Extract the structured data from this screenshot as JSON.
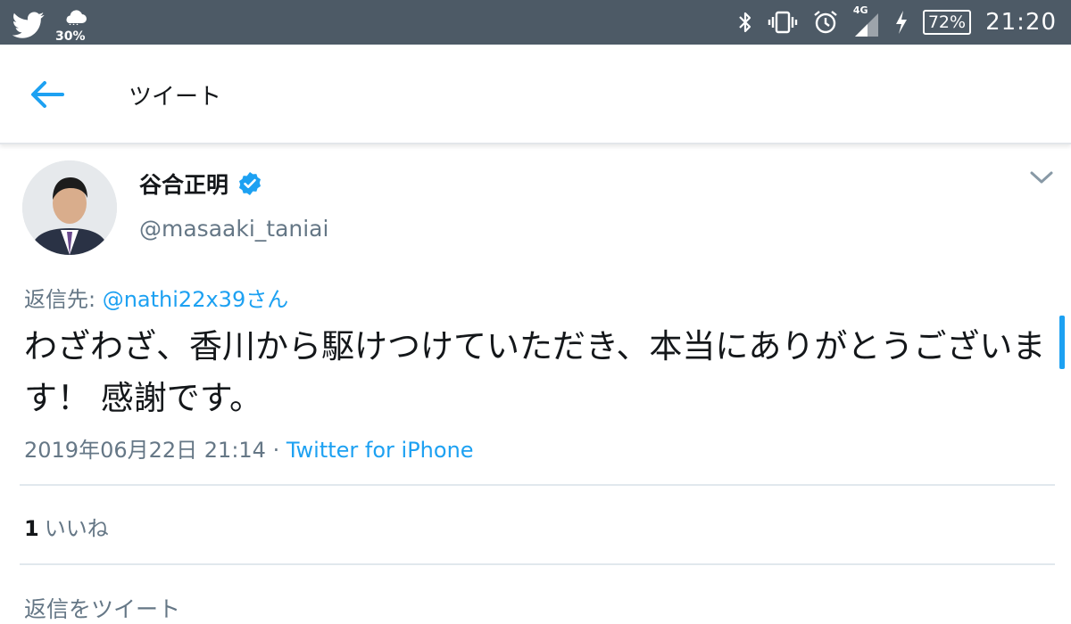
{
  "status_bar": {
    "weather_percent": "30%",
    "network_label": "4G",
    "battery": "72%",
    "time": "21:20",
    "icons": [
      "twitter-icon",
      "cloud-icon",
      "bluetooth-icon",
      "vibrate-icon",
      "alarm-icon",
      "signal-icon",
      "charging-icon",
      "battery-icon"
    ]
  },
  "header": {
    "title": "ツイート"
  },
  "tweet": {
    "author_name": "谷合正明",
    "author_handle": "@masaaki_taniai",
    "reply_prefix": "返信先: ",
    "reply_to": "@nathi22x39さん",
    "text": "わざわざ、香川から駆けつけていただき、本当にありがとうございます！ 感謝です。",
    "timestamp": "2019年06月22日 21:14",
    "separator": " · ",
    "source": "Twitter for iPhone",
    "like_count": "1",
    "like_label": "いいね",
    "reply_placeholder": "返信をツイート"
  },
  "colors": {
    "accent": "#1da1f2",
    "status_bar": "#4d5a66",
    "secondary_text": "#657786"
  }
}
